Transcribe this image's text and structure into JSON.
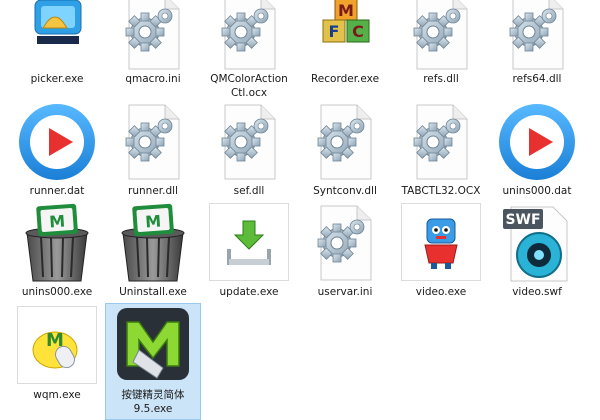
{
  "files": [
    {
      "name": "picker.exe",
      "icon": "picker-exe-icon"
    },
    {
      "name": "qmacro.ini",
      "icon": "settings-file-icon"
    },
    {
      "name": "QMColorActionCtl.ocx",
      "icon": "settings-file-icon"
    },
    {
      "name": "Recorder.exe",
      "icon": "recorder-blocks-icon"
    },
    {
      "name": "refs.dll",
      "icon": "settings-file-icon"
    },
    {
      "name": "refs64.dll",
      "icon": "settings-file-icon"
    },
    {
      "name": "runner.dat",
      "icon": "play-button-icon"
    },
    {
      "name": "runner.dll",
      "icon": "settings-file-icon"
    },
    {
      "name": "sef.dll",
      "icon": "settings-file-icon"
    },
    {
      "name": "Syntconv.dll",
      "icon": "settings-file-icon"
    },
    {
      "name": "TABCTL32.OCX",
      "icon": "settings-file-icon"
    },
    {
      "name": "unins000.dat",
      "icon": "play-button-icon"
    },
    {
      "name": "unins000.exe",
      "icon": "trash-can-icon"
    },
    {
      "name": "Uninstall.exe",
      "icon": "trash-can-icon"
    },
    {
      "name": "update.exe",
      "icon": "download-tray-icon"
    },
    {
      "name": "uservar.ini",
      "icon": "settings-file-icon"
    },
    {
      "name": "video.exe",
      "icon": "robot-video-icon"
    },
    {
      "name": "video.swf",
      "icon": "swf-file-icon"
    },
    {
      "name": "wqm.exe",
      "icon": "wqm-mouse-icon"
    },
    {
      "name": "按键精灵简体9.5.exe",
      "icon": "qm-anjian-logo-icon"
    }
  ],
  "colors": {
    "selection": "#cce4f7",
    "selection_border": "#99c9ef",
    "accent_blue": "#1e8fe0",
    "accent_red": "#e8312e",
    "accent_green": "#2e9a3a"
  }
}
